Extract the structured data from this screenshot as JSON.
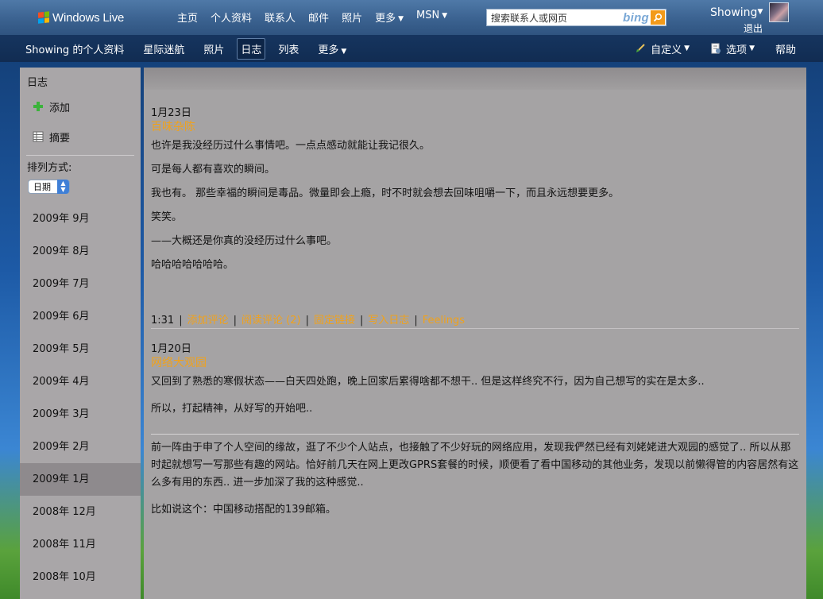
{
  "topbar": {
    "logo": "Windows Live",
    "nav": [
      {
        "label": "主页",
        "caret": false
      },
      {
        "label": "个人资料",
        "caret": false
      },
      {
        "label": "联系人",
        "caret": false
      },
      {
        "label": "邮件",
        "caret": false
      },
      {
        "label": "照片",
        "caret": false
      },
      {
        "label": "更多",
        "caret": true
      },
      {
        "label": "MSN",
        "caret": true
      }
    ],
    "search_placeholder": "搜索联系人或网页",
    "search_brand": "bing",
    "user_name": "Showing",
    "logout": "退出"
  },
  "subnav": {
    "left": [
      "Showing 的个人资料",
      "星际迷航",
      "照片",
      "日志",
      "列表",
      "更多"
    ],
    "active": "日志",
    "right": [
      "自定义",
      "选项",
      "帮助"
    ]
  },
  "sidebar": {
    "header": "日志",
    "add": "添加",
    "summary": "摘要",
    "sort_label": "排列方式:",
    "sort_value": "日期",
    "months": [
      "2009年 9月",
      "2009年 8月",
      "2009年 7月",
      "2009年 6月",
      "2009年 5月",
      "2009年 4月",
      "2009年 3月",
      "2009年 2月",
      "2009年 1月",
      "2008年 12月",
      "2008年 11月",
      "2008年 10月"
    ],
    "selected_month": "2009年 1月"
  },
  "posts": [
    {
      "date": "1月23日",
      "title": "百味杂陈",
      "paragraphs": [
        "也许是我没经历过什么事情吧。一点点感动就能让我记很久。",
        "可是每人都有喜欢的瞬间。",
        "我也有。 那些幸福的瞬间是毒品。微量即会上瘾，时不时就会想去回味咀嚼一下，而且永远想要更多。",
        "笑笑。",
        "——大概还是你真的没经历过什么事吧。",
        "哈哈哈哈哈哈哈。"
      ],
      "time": "1:31",
      "links": [
        "添加评论",
        "阅读评论 (2)",
        "固定链接",
        "写入日志",
        "Feelings"
      ]
    },
    {
      "date": "1月20日",
      "title": "网络大观园",
      "paragraphs": [
        "又回到了熟悉的寒假状态——白天四处跑，晚上回家后累得啥都不想干.. 但是这样终究不行，因为自己想写的实在是太多..",
        "所以，打起精神，从好写的开始吧.."
      ],
      "long_paragraph": "前一阵由于申了个人空间的缘故，逛了不少个人站点，也接触了不少好玩的网络应用，发现我俨然已经有刘姥姥进大观园的感觉了.. 所以从那时起就想写一写那些有趣的网站。恰好前几天在网上更改GPRS套餐的时候，顺便看了看中国移动的其他业务，发现以前懒得管的内容居然有这么多有用的东西.. 进一步加深了我的这种感觉..",
      "last_line": "比如说这个：中国移动搭配的139邮箱。"
    }
  ],
  "colors": {
    "link_orange": "#f0a21c",
    "topbar_blue": "#3b6290",
    "subnav_navy": "#132f57",
    "panel_gray": "#a5a3a4"
  }
}
